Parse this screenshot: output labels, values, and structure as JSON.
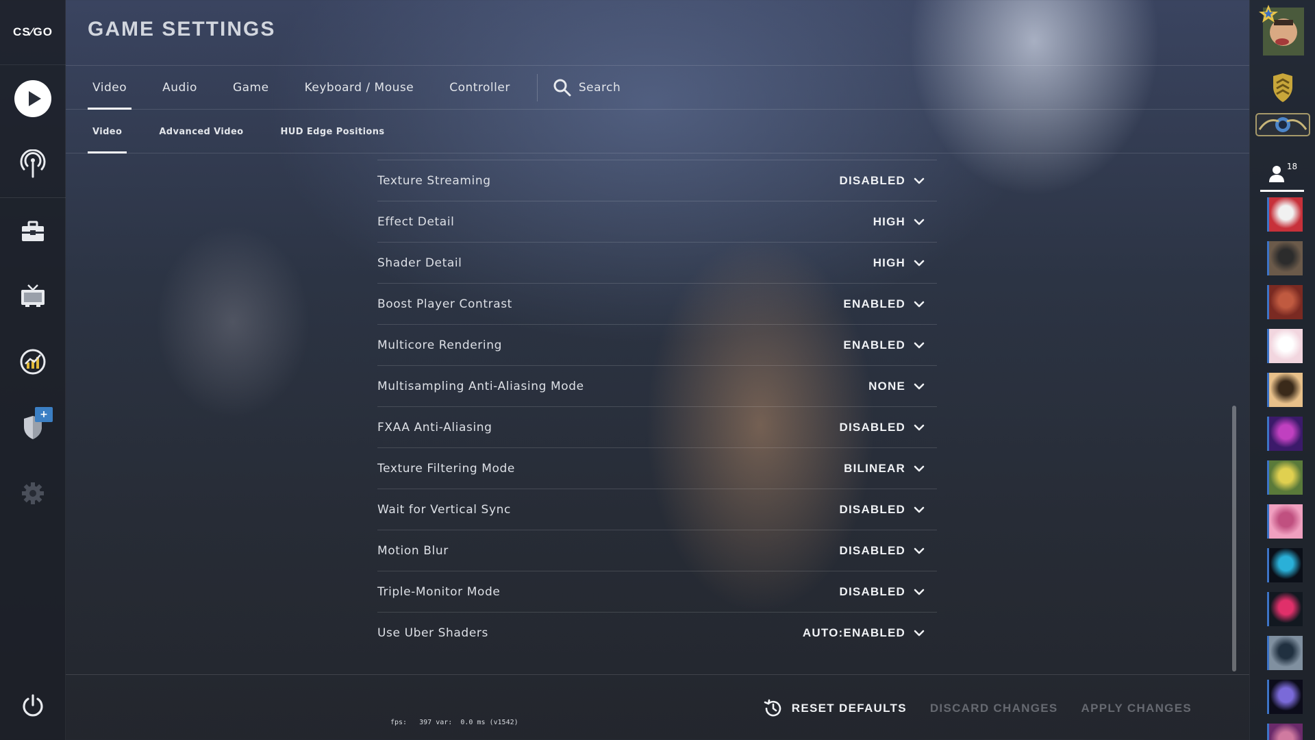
{
  "app": {
    "logo_text": "CS⁄GO",
    "title": "GAME SETTINGS"
  },
  "left_nav": {
    "items": [
      {
        "id": "play",
        "icon": "play-icon"
      },
      {
        "id": "watch",
        "icon": "broadcast-icon"
      },
      {
        "id": "inventory",
        "icon": "briefcase-icon"
      },
      {
        "id": "tv",
        "icon": "tv-icon"
      },
      {
        "id": "stats",
        "icon": "stats-icon"
      },
      {
        "id": "operation",
        "icon": "shield-icon",
        "badge": "+"
      },
      {
        "id": "settings",
        "icon": "gear-icon"
      },
      {
        "id": "quit",
        "icon": "power-icon"
      }
    ]
  },
  "main_tabs": [
    {
      "label": "Video",
      "active": true
    },
    {
      "label": "Audio",
      "active": false
    },
    {
      "label": "Game",
      "active": false
    },
    {
      "label": "Keyboard / Mouse",
      "active": false
    },
    {
      "label": "Controller",
      "active": false
    }
  ],
  "search": {
    "label": "Search",
    "icon": "search-icon"
  },
  "sub_tabs": [
    {
      "label": "Video",
      "active": true
    },
    {
      "label": "Advanced Video",
      "active": false
    },
    {
      "label": "HUD Edge Positions",
      "active": false
    }
  ],
  "settings": [
    {
      "label": "Texture Streaming",
      "value": "DISABLED"
    },
    {
      "label": "Effect Detail",
      "value": "HIGH"
    },
    {
      "label": "Shader Detail",
      "value": "HIGH"
    },
    {
      "label": "Boost Player Contrast",
      "value": "ENABLED"
    },
    {
      "label": "Multicore Rendering",
      "value": "ENABLED"
    },
    {
      "label": "Multisampling Anti-Aliasing Mode",
      "value": "NONE"
    },
    {
      "label": "FXAA Anti-Aliasing",
      "value": "DISABLED"
    },
    {
      "label": "Texture Filtering Mode",
      "value": "BILINEAR"
    },
    {
      "label": "Wait for Vertical Sync",
      "value": "DISABLED"
    },
    {
      "label": "Motion Blur",
      "value": "DISABLED"
    },
    {
      "label": "Triple-Monitor Mode",
      "value": "DISABLED"
    },
    {
      "label": "Use Uber Shaders",
      "value": "AUTO:ENABLED"
    }
  ],
  "footer": {
    "reset": "RESET DEFAULTS",
    "discard": "DISCARD CHANGES",
    "apply": "APPLY CHANGES"
  },
  "fps_readout": "fps:   397 var:  0.0 ms (v1542)",
  "right_bar": {
    "friends_count": "18",
    "friend_avatars": 13,
    "colors": {
      "avatar_accent": "#3d74c7",
      "rank_badge": "#c8a63a"
    }
  }
}
